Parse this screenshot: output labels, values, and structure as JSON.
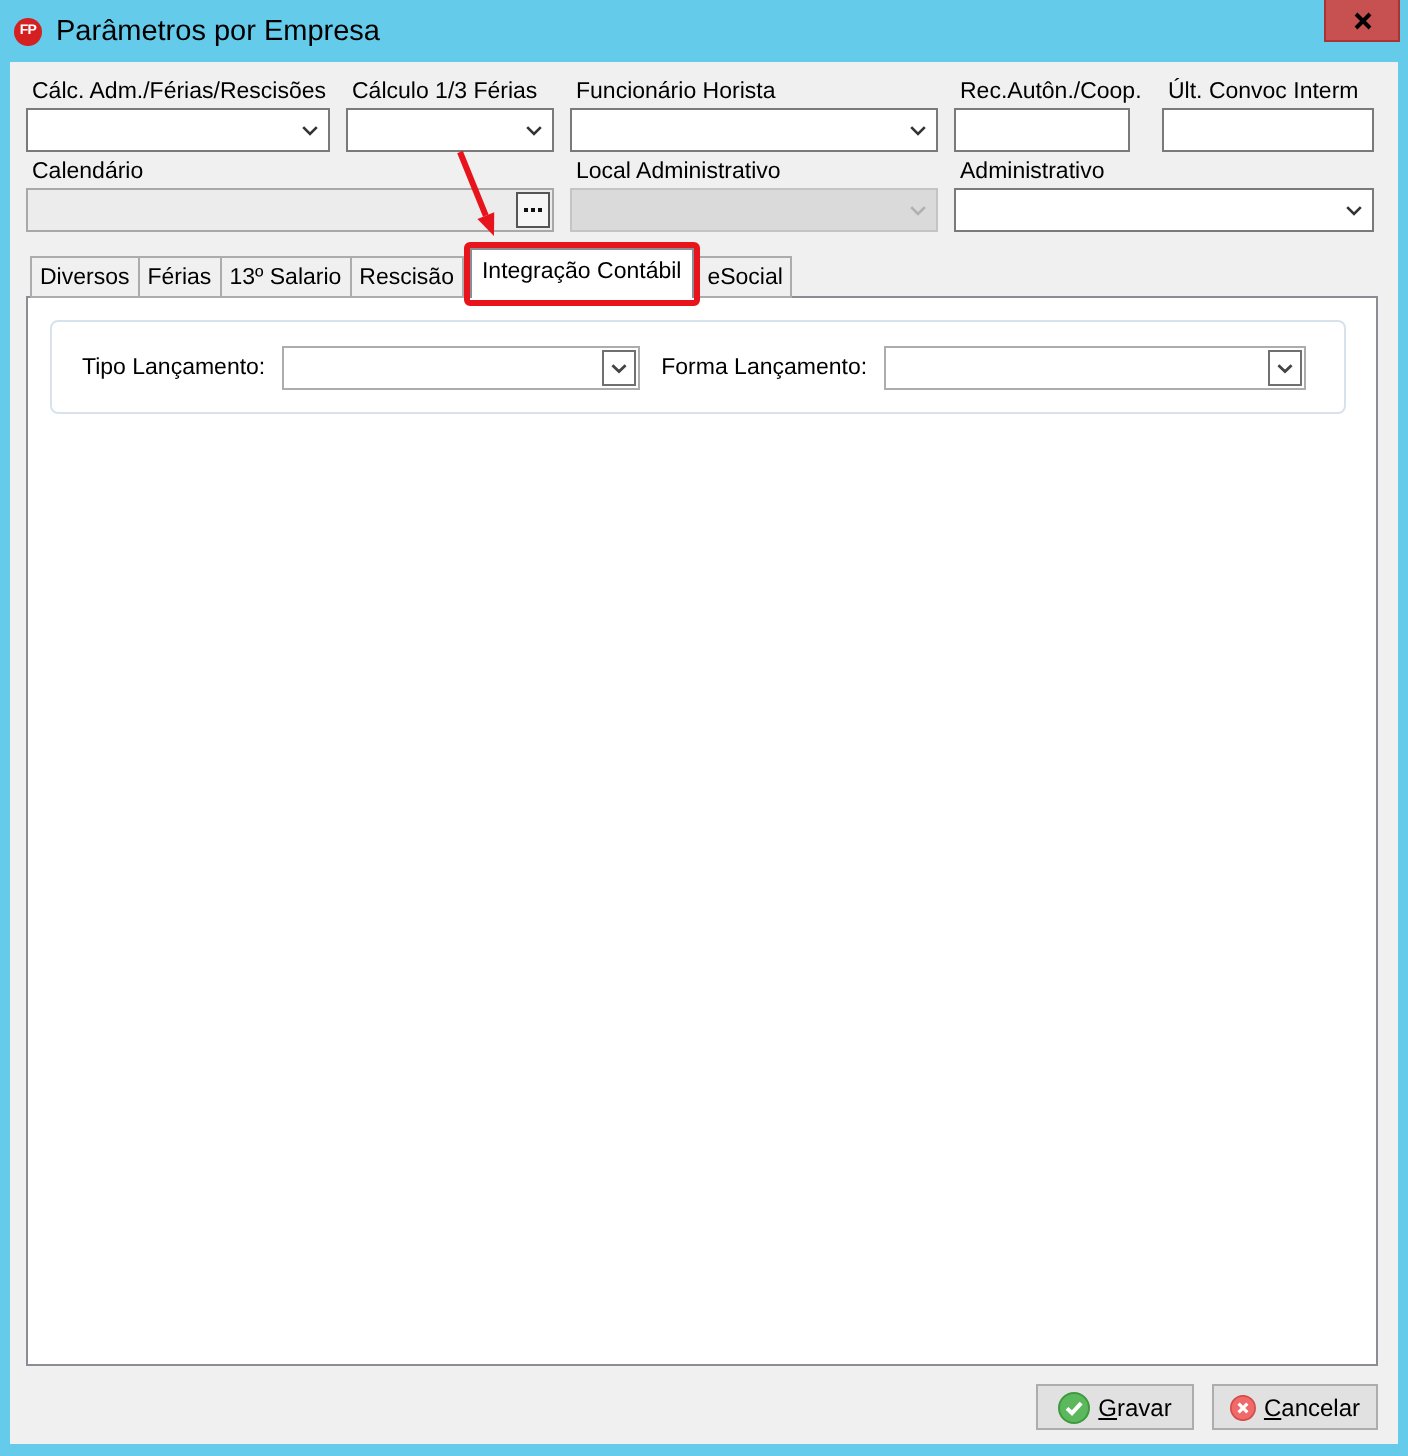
{
  "window": {
    "logo_text": "FP",
    "title": "Parâmetros por Empresa"
  },
  "fields": [
    {
      "label": "Cálc. Adm./Férias/Rescisões",
      "kind": "select",
      "disabled": false
    },
    {
      "label": "Cálculo 1/3 Férias",
      "kind": "select",
      "disabled": false
    },
    {
      "label": "Funcionário Horista",
      "kind": "select",
      "disabled": false
    },
    {
      "label": "Rec.Autôn./Coop.",
      "kind": "text",
      "disabled": false
    },
    {
      "label": "Últ. Convoc Interm",
      "kind": "text",
      "disabled": false
    },
    {
      "label": "Calendário",
      "kind": "lookup",
      "disabled": true
    },
    {
      "label": "Local Administrativo",
      "kind": "select",
      "disabled": true
    },
    {
      "label": "Administrativo",
      "kind": "select",
      "disabled": false
    }
  ],
  "tabs": [
    {
      "label": "Diversos",
      "selected": false,
      "highlighted": false
    },
    {
      "label": "Férias",
      "selected": false,
      "highlighted": false
    },
    {
      "label": "13º Salario",
      "selected": false,
      "highlighted": false
    },
    {
      "label": "Rescisão",
      "selected": false,
      "highlighted": false
    },
    {
      "label": "Integração Contábil",
      "selected": true,
      "highlighted": true
    },
    {
      "label": "eSocial",
      "selected": false,
      "highlighted": false
    }
  ],
  "panel": {
    "fields": [
      {
        "label": "Tipo Lançamento:"
      },
      {
        "label": "Forma Lançamento:"
      }
    ]
  },
  "buttons": [
    {
      "label": "Gravar",
      "kind": "confirm"
    },
    {
      "label": "Cancelar",
      "kind": "cancel"
    }
  ]
}
